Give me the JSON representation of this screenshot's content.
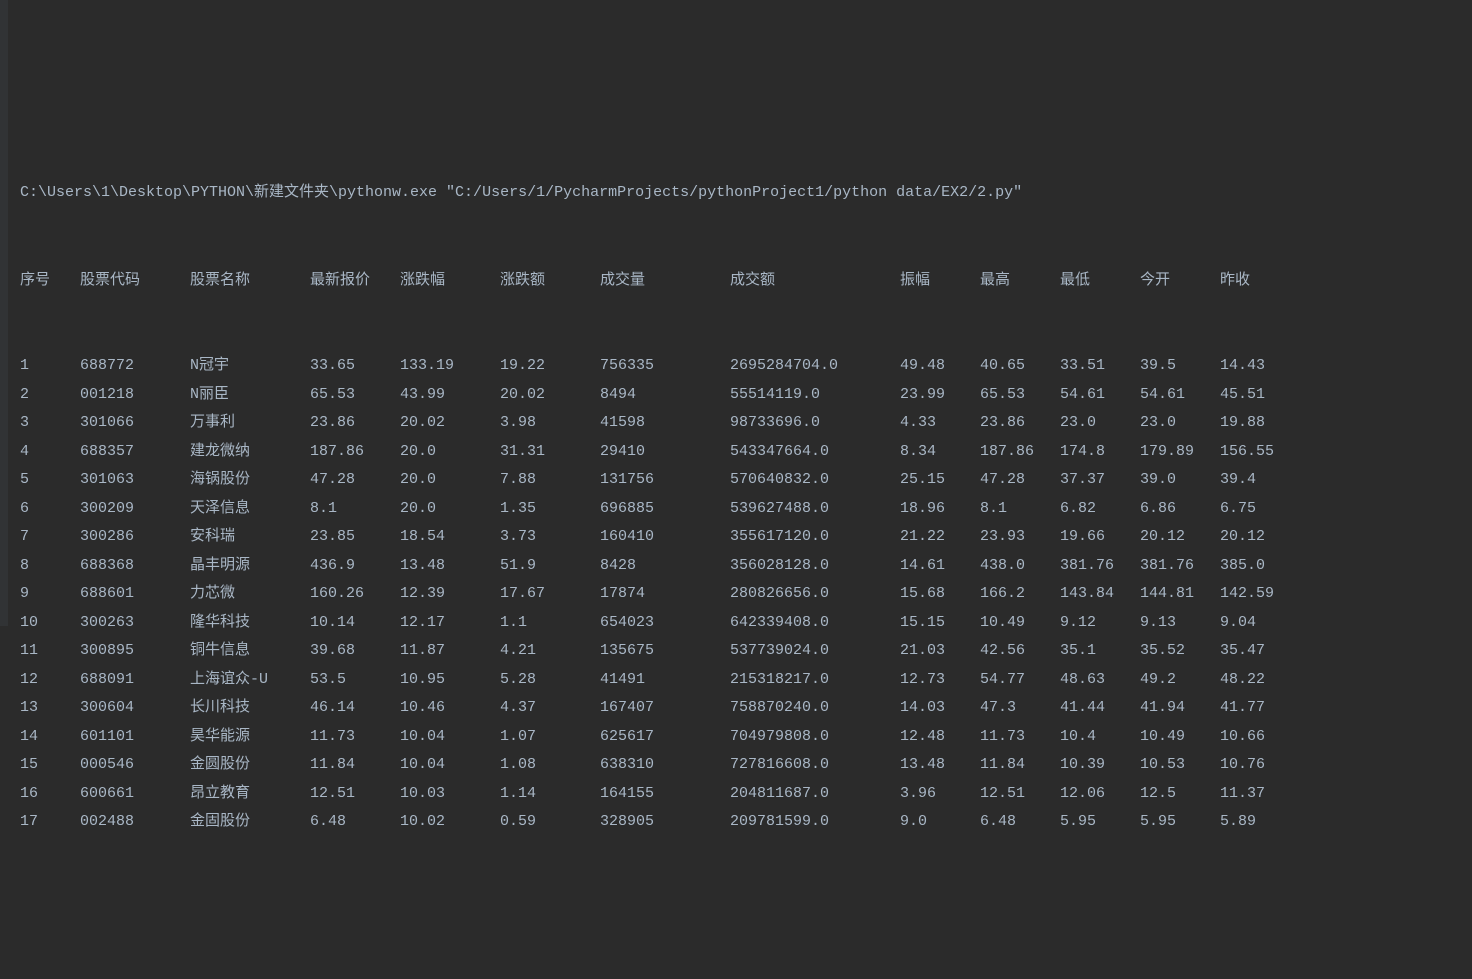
{
  "command_line": "C:\\Users\\1\\Desktop\\PYTHON\\新建文件夹\\pythonw.exe \"C:/Users/1/PycharmProjects/pythonProject1/python data/EX2/2.py\"",
  "headers": {
    "idx": "序号",
    "code": "股票代码",
    "name": "股票名称",
    "price": "最新报价",
    "chgpct": "涨跌幅",
    "chgamt": "涨跌额",
    "vol": "成交量",
    "amt": "成交额",
    "amp": "振幅",
    "high": "最高",
    "low": "最低",
    "open": "今开",
    "prev": "昨收"
  },
  "rows": [
    {
      "idx": "1",
      "code": "688772",
      "name": "N冠宇",
      "price": "33.65",
      "chgpct": "133.19",
      "chgamt": "19.22",
      "vol": "756335",
      "amt": "2695284704.0",
      "amp": "49.48",
      "high": "40.65",
      "low": "33.51",
      "open": "39.5",
      "prev": "14.43"
    },
    {
      "idx": "2",
      "code": "001218",
      "name": "N丽臣",
      "price": "65.53",
      "chgpct": "43.99",
      "chgamt": "20.02",
      "vol": "8494",
      "amt": "55514119.0",
      "amp": "23.99",
      "high": "65.53",
      "low": "54.61",
      "open": "54.61",
      "prev": "45.51"
    },
    {
      "idx": "3",
      "code": "301066",
      "name": "万事利",
      "price": "23.86",
      "chgpct": "20.02",
      "chgamt": "3.98",
      "vol": "41598",
      "amt": "98733696.0",
      "amp": "4.33",
      "high": "23.86",
      "low": "23.0",
      "open": "23.0",
      "prev": "19.88"
    },
    {
      "idx": "4",
      "code": "688357",
      "name": "建龙微纳",
      "price": "187.86",
      "chgpct": "20.0",
      "chgamt": "31.31",
      "vol": "29410",
      "amt": "543347664.0",
      "amp": "8.34",
      "high": "187.86",
      "low": "174.8",
      "open": "179.89",
      "prev": "156.55"
    },
    {
      "idx": "5",
      "code": "301063",
      "name": "海锅股份",
      "price": "47.28",
      "chgpct": "20.0",
      "chgamt": "7.88",
      "vol": "131756",
      "amt": "570640832.0",
      "amp": "25.15",
      "high": "47.28",
      "low": "37.37",
      "open": "39.0",
      "prev": "39.4"
    },
    {
      "idx": "6",
      "code": "300209",
      "name": "天泽信息",
      "price": "8.1",
      "chgpct": "20.0",
      "chgamt": "1.35",
      "vol": "696885",
      "amt": "539627488.0",
      "amp": "18.96",
      "high": "8.1",
      "low": "6.82",
      "open": "6.86",
      "prev": "6.75"
    },
    {
      "idx": "7",
      "code": "300286",
      "name": "安科瑞",
      "price": "23.85",
      "chgpct": "18.54",
      "chgamt": "3.73",
      "vol": "160410",
      "amt": "355617120.0",
      "amp": "21.22",
      "high": "23.93",
      "low": "19.66",
      "open": "20.12",
      "prev": "20.12"
    },
    {
      "idx": "8",
      "code": "688368",
      "name": "晶丰明源",
      "price": "436.9",
      "chgpct": "13.48",
      "chgamt": "51.9",
      "vol": "8428",
      "amt": "356028128.0",
      "amp": "14.61",
      "high": "438.0",
      "low": "381.76",
      "open": "381.76",
      "prev": "385.0"
    },
    {
      "idx": "9",
      "code": "688601",
      "name": "力芯微",
      "price": "160.26",
      "chgpct": "12.39",
      "chgamt": "17.67",
      "vol": "17874",
      "amt": "280826656.0",
      "amp": "15.68",
      "high": "166.2",
      "low": "143.84",
      "open": "144.81",
      "prev": "142.59"
    },
    {
      "idx": "10",
      "code": "300263",
      "name": "隆华科技",
      "price": "10.14",
      "chgpct": "12.17",
      "chgamt": "1.1",
      "vol": "654023",
      "amt": "642339408.0",
      "amp": "15.15",
      "high": "10.49",
      "low": "9.12",
      "open": "9.13",
      "prev": "9.04"
    },
    {
      "idx": "11",
      "code": "300895",
      "name": "铜牛信息",
      "price": "39.68",
      "chgpct": "11.87",
      "chgamt": "4.21",
      "vol": "135675",
      "amt": "537739024.0",
      "amp": "21.03",
      "high": "42.56",
      "low": "35.1",
      "open": "35.52",
      "prev": "35.47"
    },
    {
      "idx": "12",
      "code": "688091",
      "name": "上海谊众-U",
      "price": "53.5",
      "chgpct": "10.95",
      "chgamt": "5.28",
      "vol": "41491",
      "amt": "215318217.0",
      "amp": "12.73",
      "high": "54.77",
      "low": "48.63",
      "open": "49.2",
      "prev": "48.22"
    },
    {
      "idx": "13",
      "code": "300604",
      "name": "长川科技",
      "price": "46.14",
      "chgpct": "10.46",
      "chgamt": "4.37",
      "vol": "167407",
      "amt": "758870240.0",
      "amp": "14.03",
      "high": "47.3",
      "low": "41.44",
      "open": "41.94",
      "prev": "41.77"
    },
    {
      "idx": "14",
      "code": "601101",
      "name": "昊华能源",
      "price": "11.73",
      "chgpct": "10.04",
      "chgamt": "1.07",
      "vol": "625617",
      "amt": "704979808.0",
      "amp": "12.48",
      "high": "11.73",
      "low": "10.4",
      "open": "10.49",
      "prev": "10.66"
    },
    {
      "idx": "15",
      "code": "000546",
      "name": "金圆股份",
      "price": "11.84",
      "chgpct": "10.04",
      "chgamt": "1.08",
      "vol": "638310",
      "amt": "727816608.0",
      "amp": "13.48",
      "high": "11.84",
      "low": "10.39",
      "open": "10.53",
      "prev": "10.76"
    },
    {
      "idx": "16",
      "code": "600661",
      "name": "昂立教育",
      "price": "12.51",
      "chgpct": "10.03",
      "chgamt": "1.14",
      "vol": "164155",
      "amt": "204811687.0",
      "amp": "3.96",
      "high": "12.51",
      "low": "12.06",
      "open": "12.5",
      "prev": "11.37"
    },
    {
      "idx": "17",
      "code": "002488",
      "name": "金固股份",
      "price": "6.48",
      "chgpct": "10.02",
      "chgamt": "0.59",
      "vol": "328905",
      "amt": "209781599.0",
      "amp": "9.0",
      "high": "6.48",
      "low": "5.95",
      "open": "5.95",
      "prev": "5.89"
    }
  ]
}
